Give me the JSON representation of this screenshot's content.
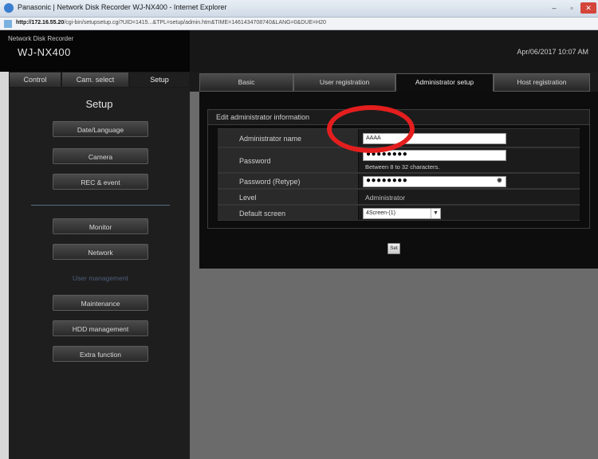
{
  "window": {
    "title": "Panasonic | Network Disk Recorder WJ-NX400 - Internet Explorer",
    "controls": {
      "minimize": "–",
      "maximize": "▫",
      "close": "✕"
    },
    "url_host": "http://172.16.55.20",
    "url_path": "/cgi-bin/setupsetup.cgi?UID=1415...&TPL=setup/admin.htm&TIME=1461434708740&LANG=0&DUE=H20"
  },
  "header": {
    "product_line": "Network Disk Recorder",
    "model": "WJ-NX400",
    "datetime": "Apr/06/2017  10:07  AM"
  },
  "left_tabs": [
    {
      "label": "Control"
    },
    {
      "label": "Cam. select"
    },
    {
      "label": "Setup"
    }
  ],
  "sidebar": {
    "title": "Setup",
    "group1": [
      {
        "label": "Date/Language"
      },
      {
        "label": "Camera"
      },
      {
        "label": "REC & event"
      }
    ],
    "group2": [
      {
        "label": "Monitor"
      },
      {
        "label": "Network"
      },
      {
        "label": "User management"
      },
      {
        "label": "Maintenance"
      },
      {
        "label": "HDD management"
      },
      {
        "label": "Extra function"
      }
    ]
  },
  "main_tabs": [
    {
      "label": "Basic"
    },
    {
      "label": "User registration"
    },
    {
      "label": "Administrator setup"
    },
    {
      "label": "Host registration"
    }
  ],
  "form": {
    "section_title": "Edit administrator information",
    "admin_name_label": "Administrator name",
    "admin_name_value": "AAAA",
    "password_label": "Password",
    "password_value": "●●●●●●●●",
    "password_hint": "Between 8 to 32 characters.",
    "password_retype_label": "Password (Retype)",
    "password_retype_value": "●●●●●●●●",
    "level_label": "Level",
    "level_value": "Administrator",
    "default_screen_label": "Default screen",
    "default_screen_value": "4Screen-(1)",
    "set_button": "Set"
  },
  "colors": {
    "annotation_circle": "#e41e1e",
    "current_nav_text": "#4d5f7a"
  }
}
